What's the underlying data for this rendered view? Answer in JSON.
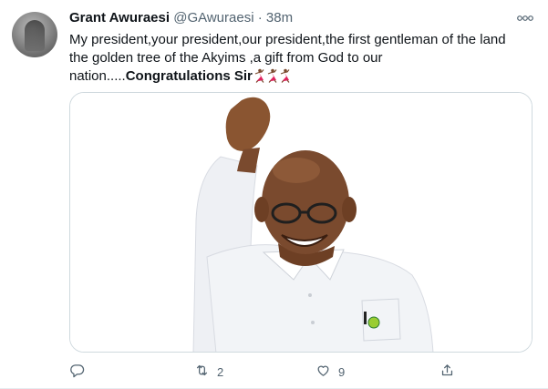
{
  "tweet": {
    "author_name": "Grant Awuraesi",
    "handle": "@GAwuraesi",
    "separator": "·",
    "time": "38m",
    "text_main": "My president,your president,our president,the first gentleman of the land the golden tree of the Akyims ,a gift from God to our nation.....",
    "text_bold": "Congratulations Sir",
    "emojis": [
      "dancer-emoji",
      "dancer-emoji",
      "dancer-emoji"
    ],
    "image_alt": "smiling-man-waving"
  },
  "actions": {
    "reply_count": "",
    "retweet_count": "2",
    "like_count": "9",
    "share_count": ""
  },
  "colors": {
    "text": "#0f1419",
    "secondary": "#536471",
    "border": "#cfd9de",
    "shirt": "#f1f3f6",
    "skin": "#7a4a2e",
    "dancer": "#e0245e"
  }
}
